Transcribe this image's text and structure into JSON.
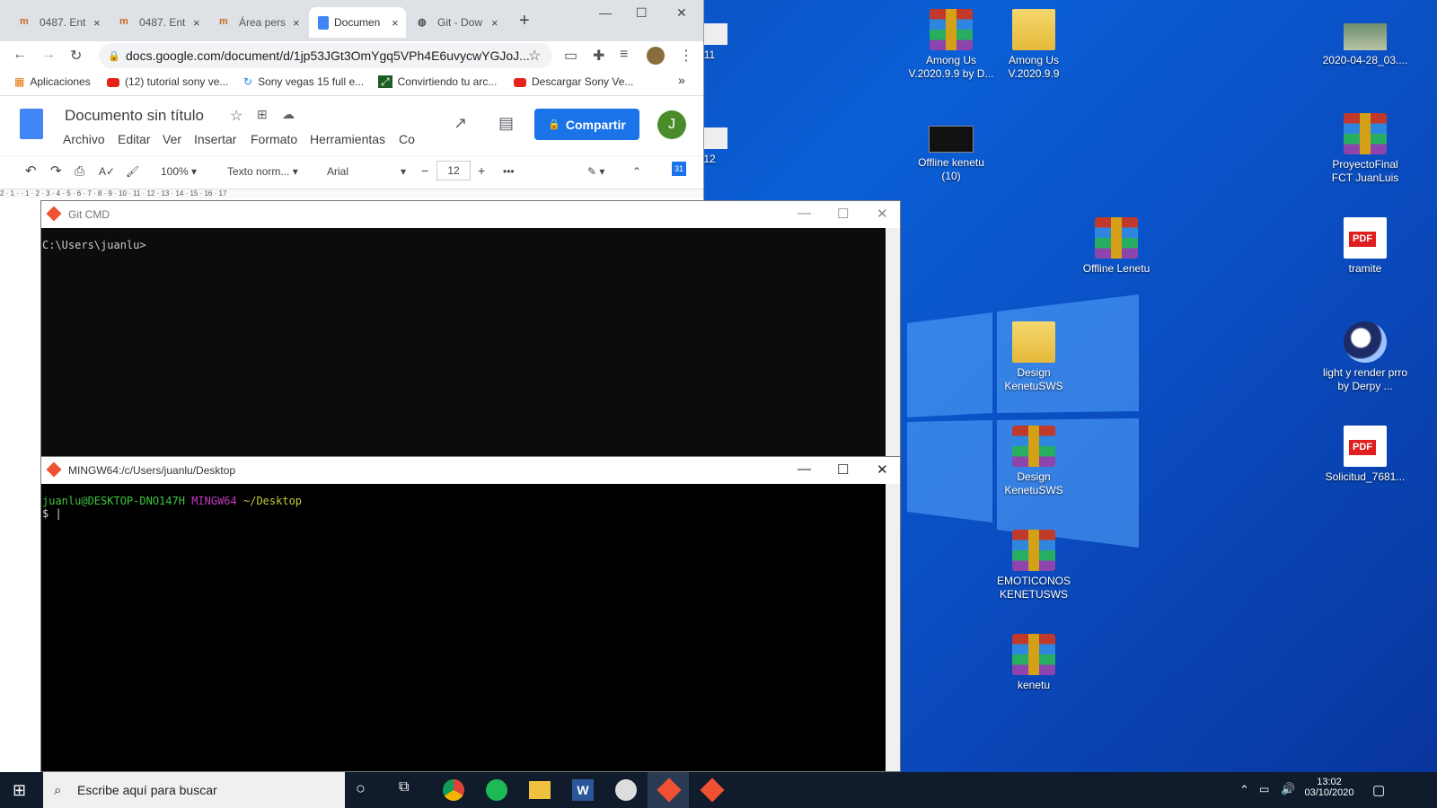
{
  "chrome": {
    "tabs": [
      {
        "label": "0487. Ent",
        "close": "×"
      },
      {
        "label": "0487. Ent",
        "close": "×"
      },
      {
        "label": "Área pers",
        "close": "×"
      },
      {
        "label": "Documen",
        "close": "×"
      },
      {
        "label": "Git - Dow",
        "close": "×"
      }
    ],
    "new_tab": "+",
    "url": "docs.google.com/document/d/1jp53JGt3OmYgq5VPh4E6uvycwYGJoJ...",
    "bookmarks": [
      "Aplicaciones",
      "(12) tutorial sony ve...",
      "Sony vegas 15 full e...",
      "Convirtiendo tu arc...",
      "Descargar Sony Ve..."
    ],
    "bookmarks_more": "»"
  },
  "docs": {
    "title": "Documento sin título",
    "menu": [
      "Archivo",
      "Editar",
      "Ver",
      "Insertar",
      "Formato",
      "Herramientas",
      "Co"
    ],
    "share": "Compartir",
    "avatar": "J",
    "zoom": "100%",
    "style": "Texto norm...",
    "font": "Arial",
    "font_size": "12",
    "ruler": "2 · 1 · · 1 · 2 · 3 · 4 · 5 · 6 · 7 · 8 · 9 · 10 · 11 · 12 · 13 · 14 · 15 · 16 · 17"
  },
  "gitcmd": {
    "title": "Git CMD",
    "prompt": "C:\\Users\\juanlu>"
  },
  "mingw": {
    "title": "MINGW64:/c/Users/juanlu/Desktop",
    "user": "juanlu@DESKTOP-DNO147H",
    "env": "MINGW64",
    "path": "~/Desktop",
    "prompt": "$ |"
  },
  "desktop_icons": [
    {
      "label": "Among Us V.2020.9.9 by D...",
      "type": "rar"
    },
    {
      "label": "Among Us V.2020.9.9",
      "type": "folder"
    },
    {
      "label": "2020-04-28_03....",
      "type": "thumb"
    },
    {
      "label": "Offline kenetu (10)",
      "type": "dark"
    },
    {
      "label": "ProyectoFinal FCT JuanLuis",
      "type": "rar"
    },
    {
      "label": "Offline Lenetu",
      "type": "rar"
    },
    {
      "label": "tramite",
      "type": "pdf"
    },
    {
      "label": "Design KenetuSWS",
      "type": "folder"
    },
    {
      "label": "light y render prro by Derpy ...",
      "type": "cinema"
    },
    {
      "label": "Design KenetuSWS",
      "type": "rar"
    },
    {
      "label": "Solicitud_7681...",
      "type": "pdf"
    },
    {
      "label": "EMOTICONOS KENETUSWS",
      "type": "rar"
    },
    {
      "label": "kenetu",
      "type": "rar"
    }
  ],
  "partial_icons": [
    "11",
    "12"
  ],
  "taskbar": {
    "search_placeholder": "Escribe aquí para buscar",
    "time": "13:02",
    "date": "03/10/2020"
  },
  "colors": {
    "share_blue": "#1a73e8",
    "term_green": "#3ec53e",
    "term_magenta": "#c03ac0",
    "term_yellow": "#c8c83a"
  }
}
